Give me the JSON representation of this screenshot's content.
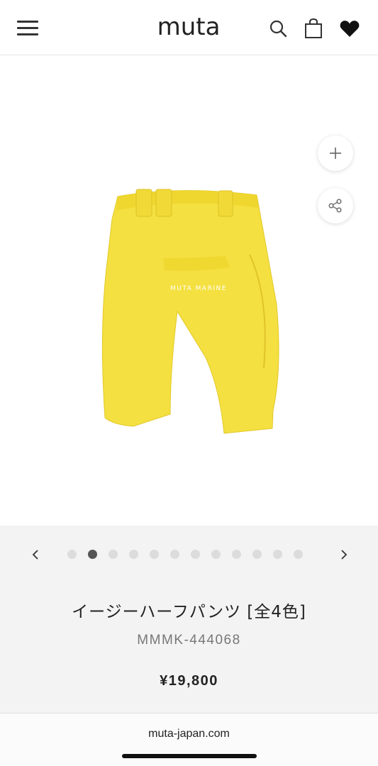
{
  "header": {
    "logo_text": "muta",
    "icons": [
      "menu-icon",
      "search-icon",
      "bag-icon",
      "heart-icon"
    ]
  },
  "image_viewer": {
    "zoom_icon": "plus-icon",
    "share_icon": "share-icon",
    "product_color": "#f4e040",
    "print_text": "MUTA MARINE"
  },
  "carousel": {
    "prev_icon": "chevron-left-icon",
    "next_icon": "chevron-right-icon",
    "total_slides": 12,
    "active_index": 1
  },
  "product": {
    "name": "イージーハーフパンツ [全4色]",
    "code": "MMMK-444068",
    "price": "¥19,800"
  },
  "browser": {
    "url": "muta-japan.com"
  },
  "colors": {
    "info_background": "#f3f3f3",
    "active_dot": "#555555",
    "inactive_dot": "#dcdcdc"
  }
}
